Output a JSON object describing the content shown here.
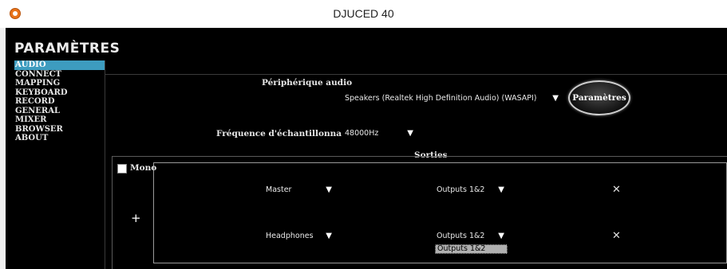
{
  "window": {
    "title": "DJUCED 40"
  },
  "page": {
    "title": "PARAMÈTRES"
  },
  "sidebar": {
    "items": [
      {
        "label": "AUDIO"
      },
      {
        "label": "CONNECT"
      },
      {
        "label": "MAPPING"
      },
      {
        "label": "KEYBOARD"
      },
      {
        "label": "RECORD"
      },
      {
        "label": "GENERAL"
      },
      {
        "label": "MIXER"
      },
      {
        "label": "BROWSER"
      },
      {
        "label": "ABOUT"
      }
    ],
    "active": "AUDIO"
  },
  "audio": {
    "device_label": "Périphérique audio",
    "device_value": "Speakers (Realtek High Definition Audio) (WASAPI)",
    "settings_button": "Paramètres",
    "sample_rate_label": "Fréquence d'échantillonnage :",
    "sample_rate_value": "48000Hz"
  },
  "outputs": {
    "section_title": "Sorties",
    "mono_label": "Mono",
    "mono_checked": false,
    "rows": [
      {
        "channel": "Master",
        "output": "Outputs 1&2"
      },
      {
        "channel": "Headphones",
        "output": "Outputs 1&2"
      }
    ],
    "open_dropdown_option": "Outputs 1&2"
  },
  "icons": {
    "caret": "▼",
    "remove": "✕",
    "add": "+"
  },
  "colors": {
    "accent": "#3d9cbf",
    "background": "#000000"
  }
}
